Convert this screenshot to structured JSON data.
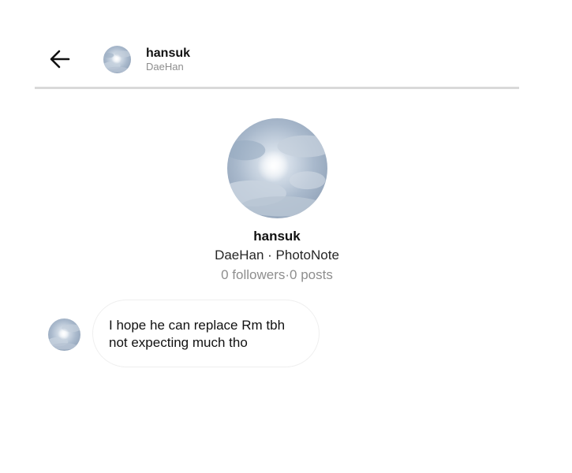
{
  "header": {
    "back_icon": "arrow-left-icon",
    "name": "hansuk",
    "subtitle": "DaeHan"
  },
  "profile": {
    "name": "hansuk",
    "meta": "DaeHan · PhotoNote",
    "stats": "0 followers·0 posts"
  },
  "messages": [
    {
      "text": "I hope he can replace Rm tbh\nnot expecting much tho"
    }
  ],
  "colors": {
    "text_primary": "#111111",
    "text_secondary": "#8e8e8e",
    "divider": "#d9d9d9",
    "bubble_border": "#efefef"
  }
}
